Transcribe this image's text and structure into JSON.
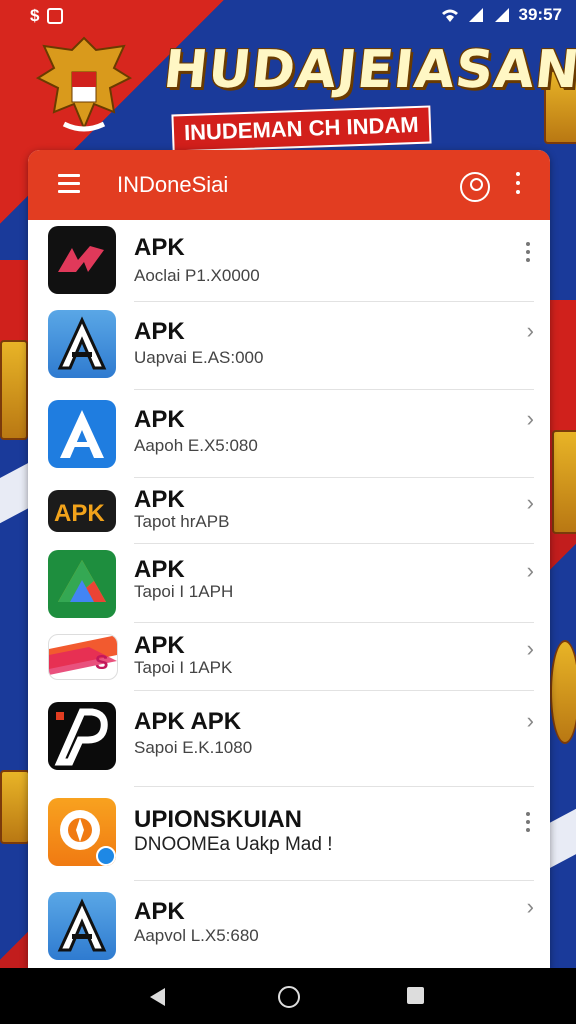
{
  "status_bar": {
    "time": "39:57"
  },
  "banner": {
    "title": "HUDAJEIASAN",
    "subtitle": "INUDEMAN CH INDAM"
  },
  "app_bar": {
    "title": "INDoneSiai"
  },
  "apps": [
    {
      "name": "APK",
      "subtitle": "Aoclai P1.X0000",
      "action": "more"
    },
    {
      "name": "APK",
      "subtitle": "Uapvai E.AS:000",
      "action": "chevron"
    },
    {
      "name": "APK",
      "subtitle": "Aapoh E.X5:080",
      "action": "chevron"
    },
    {
      "name": "APK",
      "subtitle": "Tapot hrAPB",
      "action": "chevron"
    },
    {
      "name": "APK",
      "subtitle": "Tapoi I 1APH",
      "action": "chevron"
    },
    {
      "name": "APK",
      "subtitle": "Tapoi I 1APK",
      "action": "chevron"
    },
    {
      "name": "APK APK",
      "subtitle": "Sapoi E.K.1080",
      "action": "chevron"
    },
    {
      "name": "UPIONSKUIAN",
      "subtitle": "DNOOMEa Uakp Mad !",
      "action": "more"
    },
    {
      "name": "APK",
      "subtitle": "Aapvol L.X5:680",
      "action": "chevron"
    }
  ],
  "colors": {
    "app_bar": "#e23d21",
    "background_blue": "#1a3a9a",
    "flag_red": "#d0211c"
  }
}
